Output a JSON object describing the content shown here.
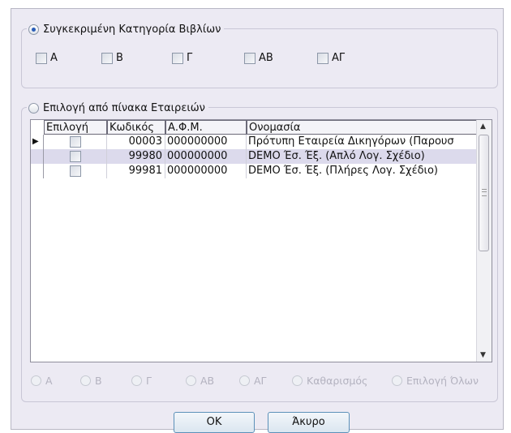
{
  "category_group": {
    "label": "Συγκεκριμένη Κατηγορία Βιβλίων",
    "checkboxes": [
      "A",
      "B",
      "Γ",
      "AB",
      "ΑΓ"
    ]
  },
  "company_group": {
    "label": "Επιλογή από πίνακα Εταιρειών",
    "table": {
      "columns": [
        "Επιλογή",
        "Κωδικός",
        "Α.Φ.Μ.",
        "Ονομασία"
      ],
      "rows": [
        {
          "code": "00003",
          "afm": "000000000",
          "name": "Πρότυπη Εταιρεία Δικηγόρων (Παρουσ"
        },
        {
          "code": "99980",
          "afm": "000000000",
          "name": "DEMO Έσ. Έξ. (Απλό Λογ. Σχέδιο)"
        },
        {
          "code": "99981",
          "afm": "000000000",
          "name": "DEMO Έσ. Έξ. (Πλήρες Λογ. Σχέδιο)"
        }
      ]
    }
  },
  "filter_radios": [
    "A",
    "B",
    "Γ",
    "AB",
    "ΑΓ",
    "Καθαρισμός",
    "Επιλογή Όλων"
  ],
  "buttons": {
    "ok": "OK",
    "cancel": "Άκυρο"
  }
}
